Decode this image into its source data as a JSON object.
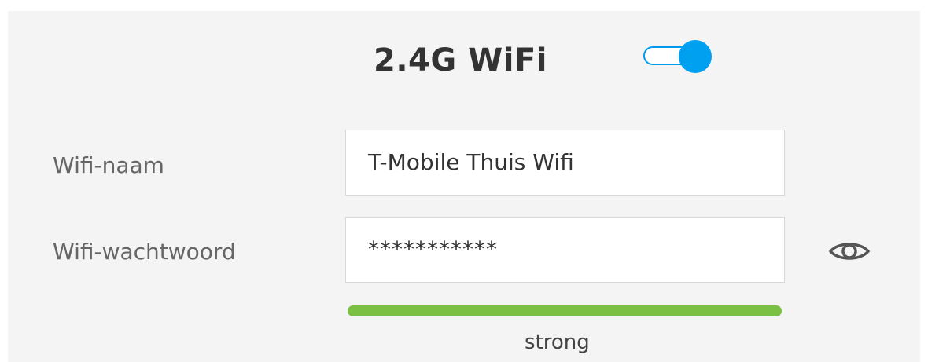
{
  "header": {
    "title": "2.4G WiFi",
    "toggle_state": "on",
    "toggle_color": "#00a0f0"
  },
  "form": {
    "name_label": "Wifi-naam",
    "name_value": "T-Mobile Thuis Wifi",
    "password_label": "Wifi-wachtwoord",
    "password_value": "***********",
    "show_password_icon": "eye-icon",
    "strength": {
      "label": "strong",
      "level": 1.0,
      "color": "#7ac143"
    }
  }
}
